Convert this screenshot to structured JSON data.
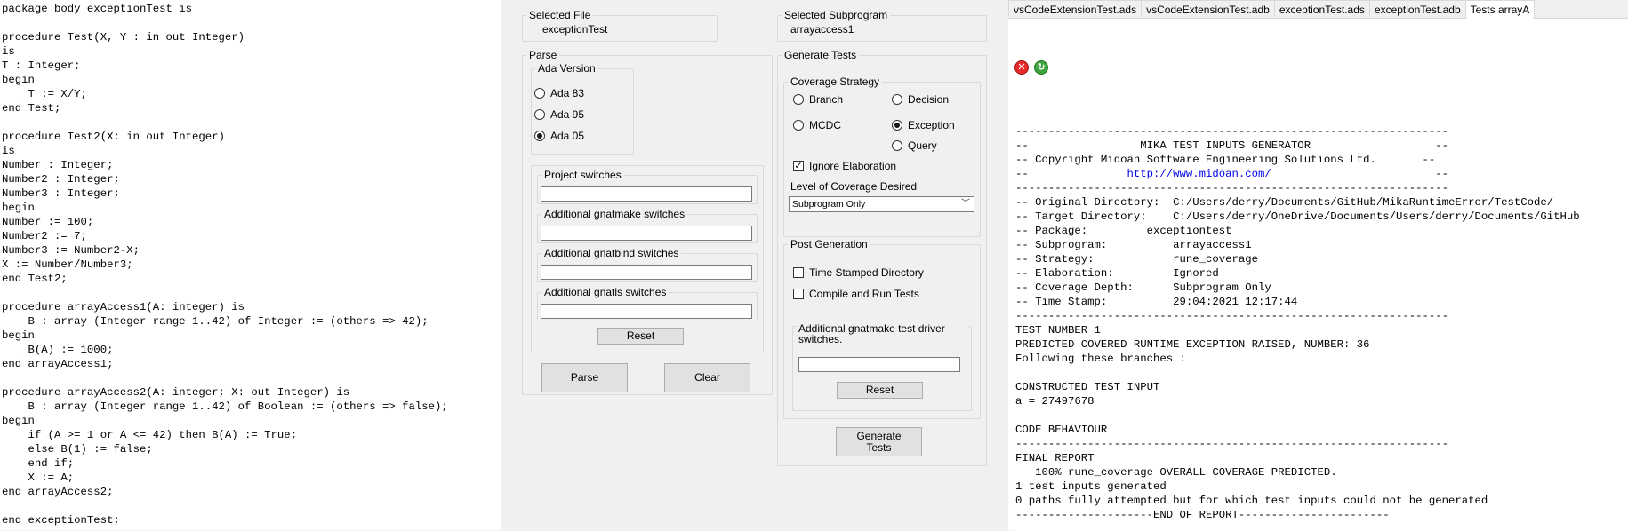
{
  "code": {
    "lines": [
      "package body exceptionTest is",
      "",
      "procedure Test(X, Y : in out Integer)",
      "is",
      "T : Integer;",
      "begin",
      "    T := X/Y;",
      "end Test;",
      "",
      "procedure Test2(X: in out Integer)",
      "is",
      "Number : Integer;",
      "Number2 : Integer;",
      "Number3 : Integer;",
      "begin",
      "Number := 100;",
      "Number2 := 7;",
      "Number3 := Number2-X;",
      "X := Number/Number3;",
      "end Test2;",
      "",
      "procedure arrayAccess1(A: integer) is",
      "    B : array (Integer range 1..42) of Integer := (others => 42);",
      "begin",
      "    B(A) := 1000;",
      "end arrayAccess1;",
      "",
      "procedure arrayAccess2(A: integer; X: out Integer) is",
      "    B : array (Integer range 1..42) of Boolean := (others => false);",
      "begin",
      "    if (A >= 1 or A <= 42) then B(A) := True;",
      "    else B(1) := false;",
      "    end if;",
      "    X := A;",
      "end arrayAccess2;",
      "",
      "end exceptionTest;"
    ]
  },
  "selected_file": {
    "label": "Selected File",
    "value": "exceptionTest"
  },
  "selected_subprogram": {
    "label": "Selected Subprogram",
    "value": "arrayaccess1"
  },
  "parse": {
    "label": "Parse",
    "ada_version": {
      "label": "Ada Version",
      "options": [
        "Ada 83",
        "Ada 95",
        "Ada 05"
      ],
      "selected": "Ada 05"
    },
    "project_switches": {
      "label": "Project switches",
      "value": ""
    },
    "gnatmake_switches": {
      "label": "Additional gnatmake switches",
      "value": ""
    },
    "gnatbind_switches": {
      "label": "Additional gnatbind switches",
      "value": ""
    },
    "gnatls_switches": {
      "label": "Additional gnatls switches",
      "value": ""
    },
    "reset_label": "Reset",
    "parse_label": "Parse",
    "clear_label": "Clear"
  },
  "generate": {
    "label": "Generate Tests",
    "coverage": {
      "label": "Coverage Strategy",
      "options": [
        "Branch",
        "Decision",
        "MCDC",
        "Exception",
        "Query"
      ],
      "selected": "Exception"
    },
    "ignore_elaboration": {
      "label": "Ignore Elaboration",
      "checked": true
    },
    "level_label": "Level of Coverage Desired",
    "level_value": "Subprogram Only",
    "post": {
      "label": "Post Generation",
      "time_stamped": {
        "label": "Time Stamped Directory",
        "checked": false
      },
      "compile_run": {
        "label": "Compile and Run Tests",
        "checked": false
      },
      "driver_switches_label": "Additional gnatmake test driver switches.",
      "driver_switches_value": "",
      "reset_label": "Reset"
    },
    "generate_label": "Generate\nTests"
  },
  "tabs": [
    {
      "label": "vsCodeExtensionTest.ads",
      "active": false
    },
    {
      "label": "vsCodeExtensionTest.adb",
      "active": false
    },
    {
      "label": "exceptionTest.ads",
      "active": false
    },
    {
      "label": "exceptionTest.adb",
      "active": false
    },
    {
      "label": "Tests arrayA",
      "active": true
    }
  ],
  "toolbar": {
    "close_icon": "close-icon",
    "refresh_icon": "refresh-icon",
    "close_color": "#e52b2b",
    "refresh_color": "#3fa33f"
  },
  "report": {
    "rule": "------------------------------------------------------------------",
    "header_title": "--                 MIKA TEST INPUTS GENERATOR                   --",
    "header_copyright": "-- Copyright Midoan Software Engineering Solutions Ltd.       --",
    "header_url_prefix": "--               ",
    "header_url": "http://www.midoan.com/",
    "header_url_suffix": "                         --",
    "lines_meta": [
      "-- Original Directory:  C:/Users/derry/Documents/GitHub/MikaRuntimeError/TestCode/",
      "-- Target Directory:    C:/Users/derry/OneDrive/Documents/Users/derry/Documents/GitHub",
      "-- Package:         exceptiontest",
      "-- Subprogram:          arrayaccess1",
      "-- Strategy:            rune_coverage",
      "-- Elaboration:         Ignored",
      "-- Coverage Depth:      Subprogram Only",
      "-- Time Stamp:          29:04:2021 12:17:44"
    ],
    "lines_body": [
      "TEST NUMBER 1",
      "PREDICTED COVERED RUNTIME EXCEPTION RAISED, NUMBER: 36",
      "Following these branches :",
      "",
      "CONSTRUCTED TEST INPUT",
      "a = 27497678",
      "",
      "CODE BEHAVIOUR",
      "------------------------------------------------------------------",
      "FINAL REPORT",
      "   100% rune_coverage OVERALL COVERAGE PREDICTED.",
      "1 test inputs generated",
      "0 paths fully attempted but for which test inputs could not be generated",
      "---------------------END OF REPORT-----------------------"
    ]
  }
}
